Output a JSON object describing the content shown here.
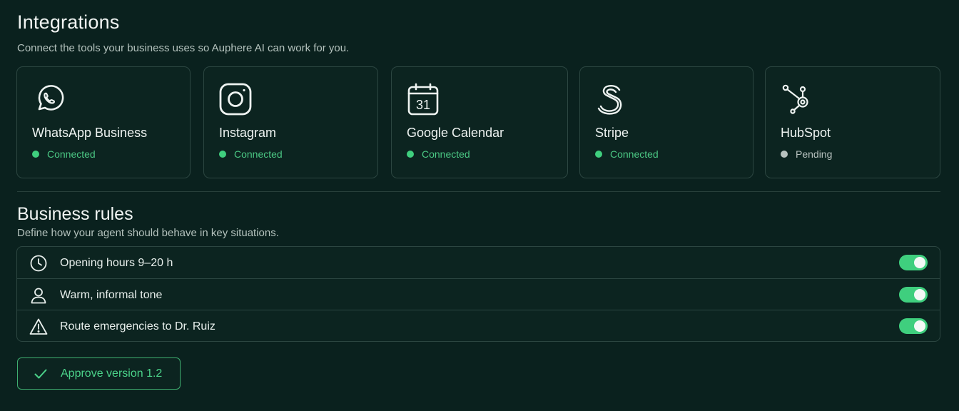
{
  "integrations": {
    "title": "Integrations",
    "subtitle": "Connect the tools your business uses so Auphere AI can work for you.",
    "cards": [
      {
        "name": "WhatsApp Business",
        "status": "Connected",
        "icon": "whatsapp-icon"
      },
      {
        "name": "Instagram",
        "status": "Connected",
        "icon": "instagram-icon"
      },
      {
        "name": "Google Calendar",
        "status": "Connected",
        "icon": "calendar-icon",
        "icon_text": "31"
      },
      {
        "name": "Stripe",
        "status": "Connected",
        "icon": "stripe-icon"
      },
      {
        "name": "HubSpot",
        "status": "Pending",
        "icon": "hubspot-icon"
      }
    ]
  },
  "business_rules": {
    "title": "Business rules",
    "subtitle": "Define how your agent should behave in key situations.",
    "rules": [
      {
        "label": "Opening hours 9–20 h",
        "icon": "clock-icon",
        "enabled": true
      },
      {
        "label": "Warm, informal tone",
        "icon": "user-icon",
        "enabled": true
      },
      {
        "label": "Route emergencies to Dr. Ruiz",
        "icon": "warning-icon",
        "enabled": true
      }
    ]
  },
  "approve": {
    "label": "Approve version 1.2",
    "icon": "check-icon"
  },
  "colors": {
    "background": "#0a211e",
    "accent": "#3fcf7e",
    "pending": "#b8c2bf"
  }
}
